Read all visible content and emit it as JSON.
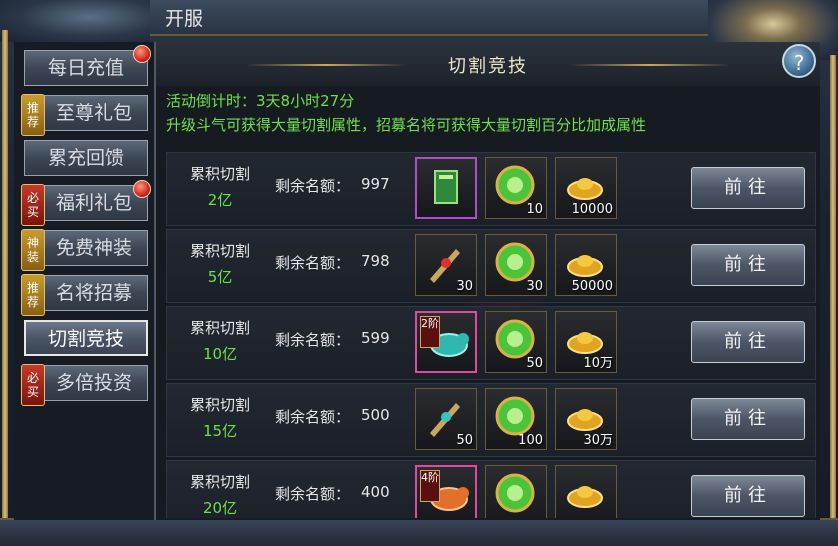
{
  "window": {
    "title": "开服"
  },
  "sidebar": {
    "items": [
      {
        "label": "每日充值",
        "tag": "",
        "dot": true,
        "active": false
      },
      {
        "label": "至尊礼包",
        "tag": "推荐",
        "dot": false,
        "active": false
      },
      {
        "label": "累充回馈",
        "tag": "",
        "dot": false,
        "active": false
      },
      {
        "label": "福利礼包",
        "tag": "必买",
        "dot": true,
        "active": false
      },
      {
        "label": "免费神装",
        "tag": "神装",
        "dot": false,
        "active": false
      },
      {
        "label": "名将招募",
        "tag": "推荐",
        "dot": false,
        "active": false
      },
      {
        "label": "切割竞技",
        "tag": "",
        "dot": false,
        "active": true
      },
      {
        "label": "多倍投资",
        "tag": "必买",
        "dot": false,
        "active": false
      }
    ]
  },
  "panel": {
    "title": "切割竞技",
    "help": "?",
    "countdown_label": "活动倒计时：",
    "countdown_value": "3天8小时27分",
    "description": "升级斗气可获得大量切割属性，招募名将可获得大量切割百分比加成属性"
  },
  "rows": [
    {
      "name": "累积切割",
      "amount": "2亿",
      "quota_label": "剩余名额：",
      "quota": "997",
      "rewards": [
        {
          "icon": "green-book-icon",
          "count": "",
          "frame": "purple",
          "rank": ""
        },
        {
          "icon": "green-gem-icon",
          "count": "10",
          "frame": "",
          "rank": ""
        },
        {
          "icon": "gold-ingot-icon",
          "count": "10000",
          "frame": "",
          "rank": ""
        }
      ],
      "button": "前往"
    },
    {
      "name": "累积切割",
      "amount": "5亿",
      "quota_label": "剩余名额：",
      "quota": "798",
      "rewards": [
        {
          "icon": "red-weapon-icon",
          "count": "30",
          "frame": "",
          "rank": ""
        },
        {
          "icon": "green-gem-icon",
          "count": "30",
          "frame": "",
          "rank": ""
        },
        {
          "icon": "gold-ingot-icon",
          "count": "50000",
          "frame": "",
          "rank": ""
        }
      ],
      "button": "前往"
    },
    {
      "name": "累积切割",
      "amount": "10亿",
      "quota_label": "剩余名额：",
      "quota": "599",
      "rewards": [
        {
          "icon": "cyan-mount-icon",
          "count": "",
          "frame": "pink",
          "rank": "2阶"
        },
        {
          "icon": "green-gem-icon",
          "count": "50",
          "frame": "",
          "rank": ""
        },
        {
          "icon": "gold-ingot-icon",
          "count": "10万",
          "frame": "",
          "rank": ""
        }
      ],
      "button": "前往"
    },
    {
      "name": "累积切割",
      "amount": "15亿",
      "quota_label": "剩余名额：",
      "quota": "500",
      "rewards": [
        {
          "icon": "cyan-weapon-icon",
          "count": "50",
          "frame": "",
          "rank": ""
        },
        {
          "icon": "green-gem-icon",
          "count": "100",
          "frame": "",
          "rank": ""
        },
        {
          "icon": "gold-ingot-icon",
          "count": "30万",
          "frame": "",
          "rank": ""
        }
      ],
      "button": "前往"
    },
    {
      "name": "累积切割",
      "amount": "20亿",
      "quota_label": "剩余名额：",
      "quota": "400",
      "rewards": [
        {
          "icon": "orange-mount-icon",
          "count": "",
          "frame": "pink",
          "rank": "4阶"
        },
        {
          "icon": "green-gem-icon",
          "count": "",
          "frame": "",
          "rank": ""
        },
        {
          "icon": "gold-ingot-icon",
          "count": "",
          "frame": "",
          "rank": ""
        }
      ],
      "button": "前往"
    }
  ],
  "colors": {
    "highlight_green": "#6fe04a",
    "accent_gold": "#c9a760"
  }
}
